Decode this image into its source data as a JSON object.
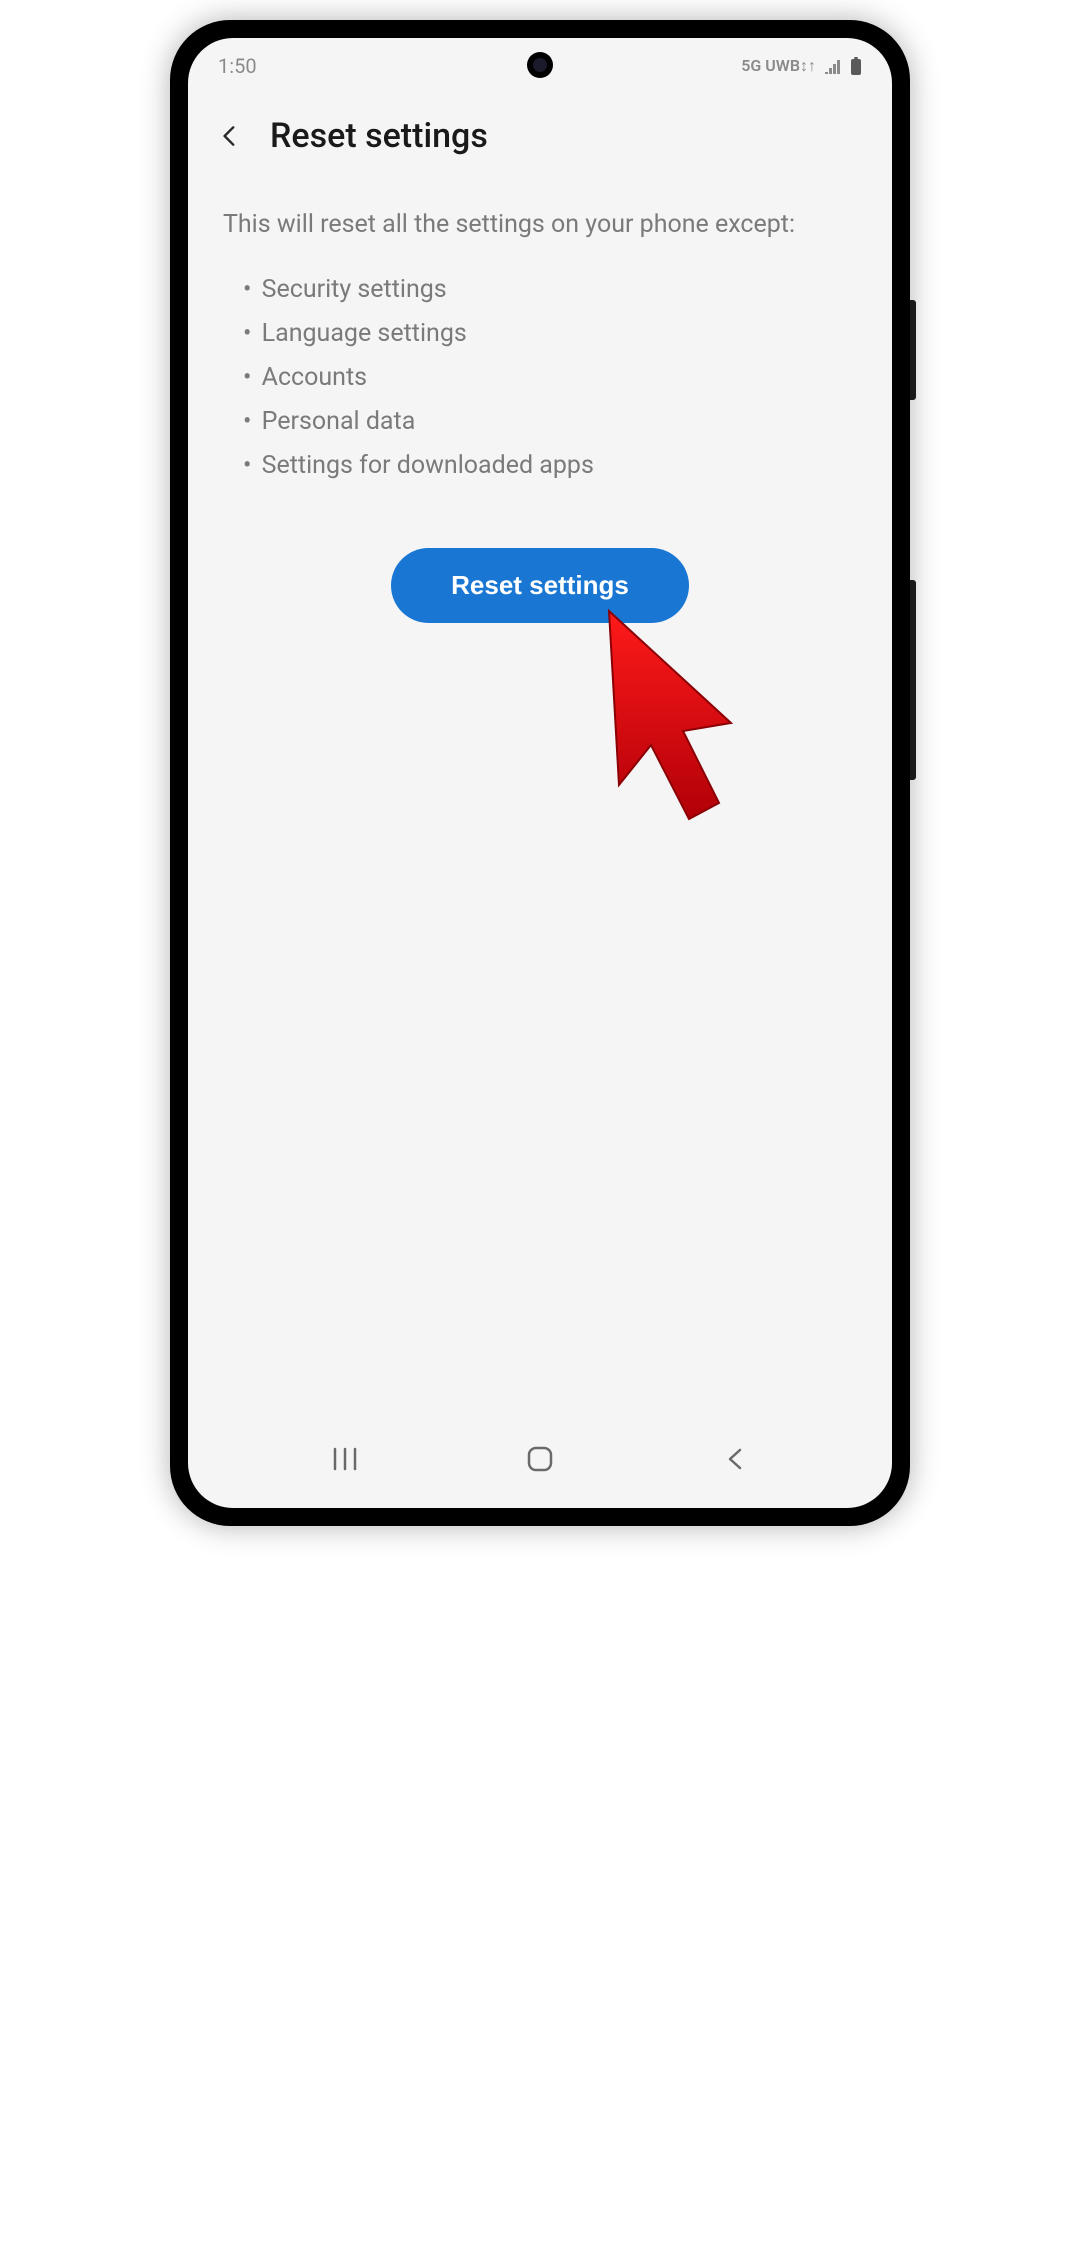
{
  "status_bar": {
    "time": "1:50",
    "network": "5G UWB↕↑"
  },
  "header": {
    "title": "Reset settings"
  },
  "content": {
    "description": "This will reset all the settings on your phone except:",
    "exceptions": [
      "Security settings",
      "Language settings",
      "Accounts",
      "Personal data",
      "Settings for downloaded apps"
    ]
  },
  "button": {
    "label": "Reset settings"
  },
  "colors": {
    "accent": "#1976d2",
    "cursor": "#e30613"
  }
}
